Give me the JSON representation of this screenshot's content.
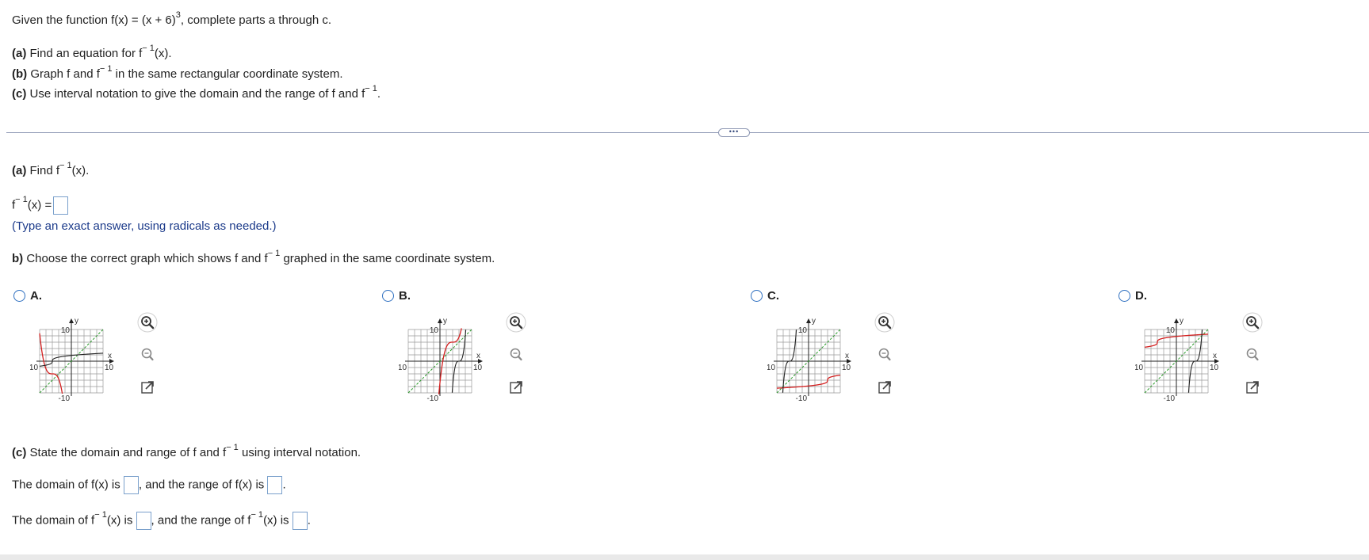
{
  "intro": {
    "pre": "Given the function f(x) = (x + 6)",
    "sup": "3",
    "post": ", complete parts a through c."
  },
  "parts_list": {
    "a_tag": "(a)",
    "a_pre": "Find an equation for f",
    "a_sup": "− 1",
    "a_post": "(x).",
    "b_tag": "(b)",
    "b_pre": "Graph f and f",
    "b_sup": "− 1",
    "b_post": "in the same rectangular coordinate system.",
    "c_tag": "(c)",
    "c_pre": "Use interval notation to give the domain and the range of f and f",
    "c_sup": "− 1",
    "c_post": "."
  },
  "separator_button": "•••",
  "part_a": {
    "tag": "(a)",
    "pre": "Find f",
    "sup": "− 1",
    "post": "(x).",
    "answer_pre": "f",
    "answer_sup": "− 1",
    "answer_post": "(x) =",
    "hint": "(Type an exact answer, using radicals as needed.)"
  },
  "part_b": {
    "tag": "b)",
    "pre": "Choose the correct graph which shows f and f",
    "sup": "− 1",
    "post": "graphed in the same coordinate system."
  },
  "options": [
    {
      "letter": "A.",
      "axis_x": "x",
      "axis_y": "y",
      "tick_pos": "10",
      "tick_neg": "-10",
      "tick_y_pos": "10",
      "tick_y_neg": "-10"
    },
    {
      "letter": "B.",
      "axis_x": "x",
      "axis_y": "y",
      "tick_pos": "10",
      "tick_neg": "-10",
      "tick_y_pos": "10",
      "tick_y_neg": "-10"
    },
    {
      "letter": "C.",
      "axis_x": "x",
      "axis_y": "y",
      "tick_pos": "10",
      "tick_neg": "-10",
      "tick_y_pos": "10",
      "tick_y_neg": "-10"
    },
    {
      "letter": "D.",
      "axis_x": "x",
      "axis_y": "y",
      "tick_pos": "10",
      "tick_neg": "-10",
      "tick_y_pos": "10",
      "tick_y_neg": "-10"
    }
  ],
  "tools": [
    "zoom-in-icon",
    "zoom-out-icon",
    "popout-icon"
  ],
  "part_c": {
    "tag": "(c)",
    "pre": "State the domain and range of f and f",
    "sup": "− 1",
    "post": "using interval notation.",
    "line1_pre": "The domain of f(x) is",
    "line1_mid": ", and the range of f(x) is",
    "line1_end": ".",
    "line2_pre_a": "The domain of f",
    "line2_sup_a": "− 1",
    "line2_pre_b": "(x) is",
    "line2_mid_a": ", and the range of f",
    "line2_sup_b": "− 1",
    "line2_mid_b": "(x) is",
    "line2_end": "."
  },
  "colors": {
    "f_curve": "#d42020",
    "finv_curve": "#222222",
    "identity_line": "#2a9a2a",
    "grid": "#9a9a9a",
    "radio": "#2d6fc0",
    "hint": "#1b3a8a"
  }
}
